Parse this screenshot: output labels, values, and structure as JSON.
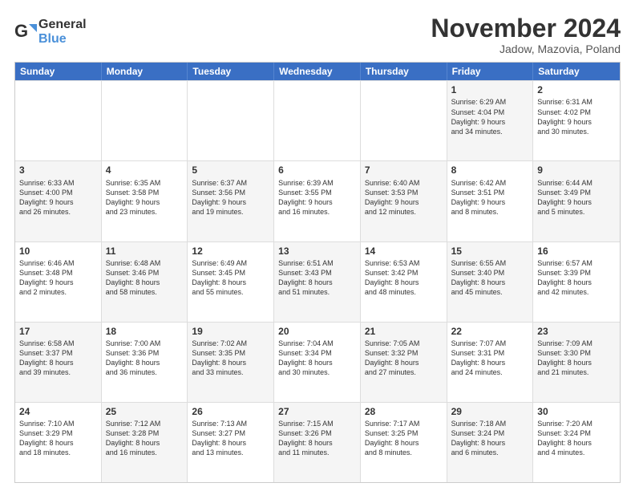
{
  "logo": {
    "line1": "General",
    "line2": "Blue"
  },
  "title": "November 2024",
  "location": "Jadow, Mazovia, Poland",
  "days_of_week": [
    "Sunday",
    "Monday",
    "Tuesday",
    "Wednesday",
    "Thursday",
    "Friday",
    "Saturday"
  ],
  "weeks": [
    [
      {
        "day": "",
        "info": "",
        "shaded": false
      },
      {
        "day": "",
        "info": "",
        "shaded": false
      },
      {
        "day": "",
        "info": "",
        "shaded": false
      },
      {
        "day": "",
        "info": "",
        "shaded": false
      },
      {
        "day": "",
        "info": "",
        "shaded": false
      },
      {
        "day": "1",
        "info": "Sunrise: 6:29 AM\nSunset: 4:04 PM\nDaylight: 9 hours\nand 34 minutes.",
        "shaded": true
      },
      {
        "day": "2",
        "info": "Sunrise: 6:31 AM\nSunset: 4:02 PM\nDaylight: 9 hours\nand 30 minutes.",
        "shaded": false
      }
    ],
    [
      {
        "day": "3",
        "info": "Sunrise: 6:33 AM\nSunset: 4:00 PM\nDaylight: 9 hours\nand 26 minutes.",
        "shaded": true
      },
      {
        "day": "4",
        "info": "Sunrise: 6:35 AM\nSunset: 3:58 PM\nDaylight: 9 hours\nand 23 minutes.",
        "shaded": false
      },
      {
        "day": "5",
        "info": "Sunrise: 6:37 AM\nSunset: 3:56 PM\nDaylight: 9 hours\nand 19 minutes.",
        "shaded": true
      },
      {
        "day": "6",
        "info": "Sunrise: 6:39 AM\nSunset: 3:55 PM\nDaylight: 9 hours\nand 16 minutes.",
        "shaded": false
      },
      {
        "day": "7",
        "info": "Sunrise: 6:40 AM\nSunset: 3:53 PM\nDaylight: 9 hours\nand 12 minutes.",
        "shaded": true
      },
      {
        "day": "8",
        "info": "Sunrise: 6:42 AM\nSunset: 3:51 PM\nDaylight: 9 hours\nand 8 minutes.",
        "shaded": false
      },
      {
        "day": "9",
        "info": "Sunrise: 6:44 AM\nSunset: 3:49 PM\nDaylight: 9 hours\nand 5 minutes.",
        "shaded": true
      }
    ],
    [
      {
        "day": "10",
        "info": "Sunrise: 6:46 AM\nSunset: 3:48 PM\nDaylight: 9 hours\nand 2 minutes.",
        "shaded": false
      },
      {
        "day": "11",
        "info": "Sunrise: 6:48 AM\nSunset: 3:46 PM\nDaylight: 8 hours\nand 58 minutes.",
        "shaded": true
      },
      {
        "day": "12",
        "info": "Sunrise: 6:49 AM\nSunset: 3:45 PM\nDaylight: 8 hours\nand 55 minutes.",
        "shaded": false
      },
      {
        "day": "13",
        "info": "Sunrise: 6:51 AM\nSunset: 3:43 PM\nDaylight: 8 hours\nand 51 minutes.",
        "shaded": true
      },
      {
        "day": "14",
        "info": "Sunrise: 6:53 AM\nSunset: 3:42 PM\nDaylight: 8 hours\nand 48 minutes.",
        "shaded": false
      },
      {
        "day": "15",
        "info": "Sunrise: 6:55 AM\nSunset: 3:40 PM\nDaylight: 8 hours\nand 45 minutes.",
        "shaded": true
      },
      {
        "day": "16",
        "info": "Sunrise: 6:57 AM\nSunset: 3:39 PM\nDaylight: 8 hours\nand 42 minutes.",
        "shaded": false
      }
    ],
    [
      {
        "day": "17",
        "info": "Sunrise: 6:58 AM\nSunset: 3:37 PM\nDaylight: 8 hours\nand 39 minutes.",
        "shaded": true
      },
      {
        "day": "18",
        "info": "Sunrise: 7:00 AM\nSunset: 3:36 PM\nDaylight: 8 hours\nand 36 minutes.",
        "shaded": false
      },
      {
        "day": "19",
        "info": "Sunrise: 7:02 AM\nSunset: 3:35 PM\nDaylight: 8 hours\nand 33 minutes.",
        "shaded": true
      },
      {
        "day": "20",
        "info": "Sunrise: 7:04 AM\nSunset: 3:34 PM\nDaylight: 8 hours\nand 30 minutes.",
        "shaded": false
      },
      {
        "day": "21",
        "info": "Sunrise: 7:05 AM\nSunset: 3:32 PM\nDaylight: 8 hours\nand 27 minutes.",
        "shaded": true
      },
      {
        "day": "22",
        "info": "Sunrise: 7:07 AM\nSunset: 3:31 PM\nDaylight: 8 hours\nand 24 minutes.",
        "shaded": false
      },
      {
        "day": "23",
        "info": "Sunrise: 7:09 AM\nSunset: 3:30 PM\nDaylight: 8 hours\nand 21 minutes.",
        "shaded": true
      }
    ],
    [
      {
        "day": "24",
        "info": "Sunrise: 7:10 AM\nSunset: 3:29 PM\nDaylight: 8 hours\nand 18 minutes.",
        "shaded": false
      },
      {
        "day": "25",
        "info": "Sunrise: 7:12 AM\nSunset: 3:28 PM\nDaylight: 8 hours\nand 16 minutes.",
        "shaded": true
      },
      {
        "day": "26",
        "info": "Sunrise: 7:13 AM\nSunset: 3:27 PM\nDaylight: 8 hours\nand 13 minutes.",
        "shaded": false
      },
      {
        "day": "27",
        "info": "Sunrise: 7:15 AM\nSunset: 3:26 PM\nDaylight: 8 hours\nand 11 minutes.",
        "shaded": true
      },
      {
        "day": "28",
        "info": "Sunrise: 7:17 AM\nSunset: 3:25 PM\nDaylight: 8 hours\nand 8 minutes.",
        "shaded": false
      },
      {
        "day": "29",
        "info": "Sunrise: 7:18 AM\nSunset: 3:24 PM\nDaylight: 8 hours\nand 6 minutes.",
        "shaded": true
      },
      {
        "day": "30",
        "info": "Sunrise: 7:20 AM\nSunset: 3:24 PM\nDaylight: 8 hours\nand 4 minutes.",
        "shaded": false
      }
    ]
  ]
}
